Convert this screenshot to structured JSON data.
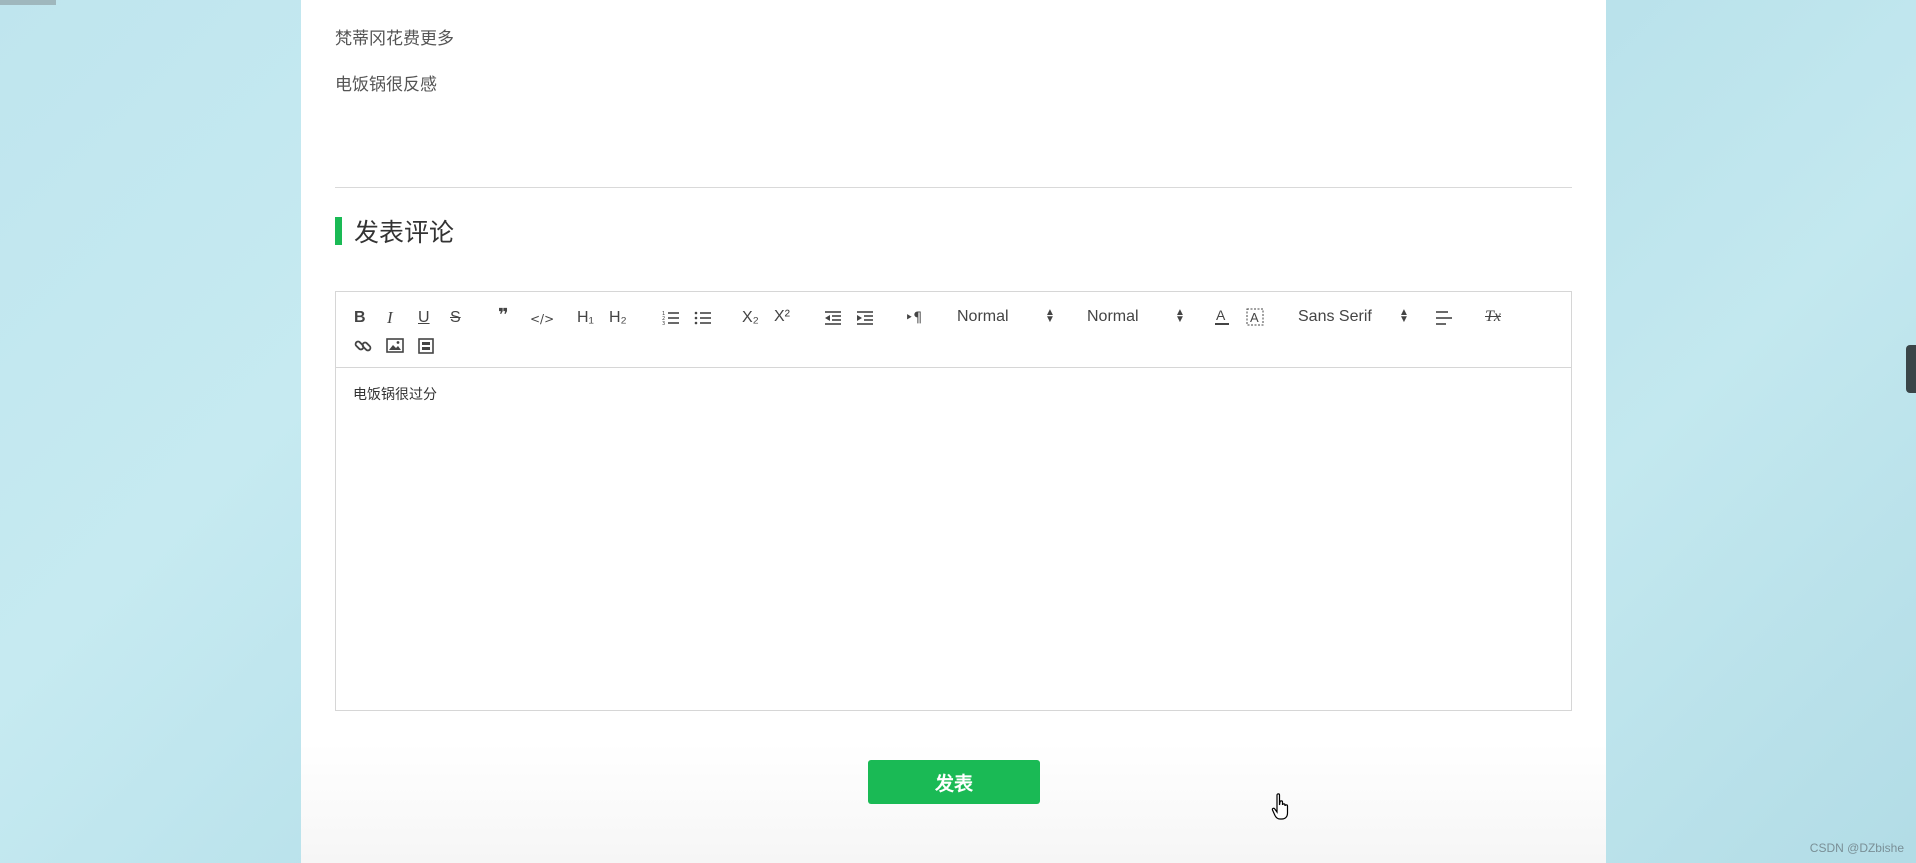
{
  "comments": {
    "line1": "梵蒂冈花费更多",
    "line2": "电饭锅很反感"
  },
  "section": {
    "title": "发表评论",
    "accent_color": "#1aba55"
  },
  "toolbar": {
    "header_select": "Normal",
    "size_select": "Normal",
    "font_select": "Sans Serif",
    "h1_label": "H₁",
    "h2_label": "H₂",
    "bold_label": "B",
    "italic_label": "I",
    "underline_label": "U",
    "strike_label": "S",
    "quote_label": "❞",
    "code_label": "</>",
    "sub_label": "X₂",
    "sup_label": "X²",
    "rtl_label": "‣¶",
    "clean_label": "Tx"
  },
  "editor": {
    "content": "电饭锅很过分"
  },
  "submit": {
    "label": "发表"
  },
  "watermark": "CSDN @DZbishe"
}
